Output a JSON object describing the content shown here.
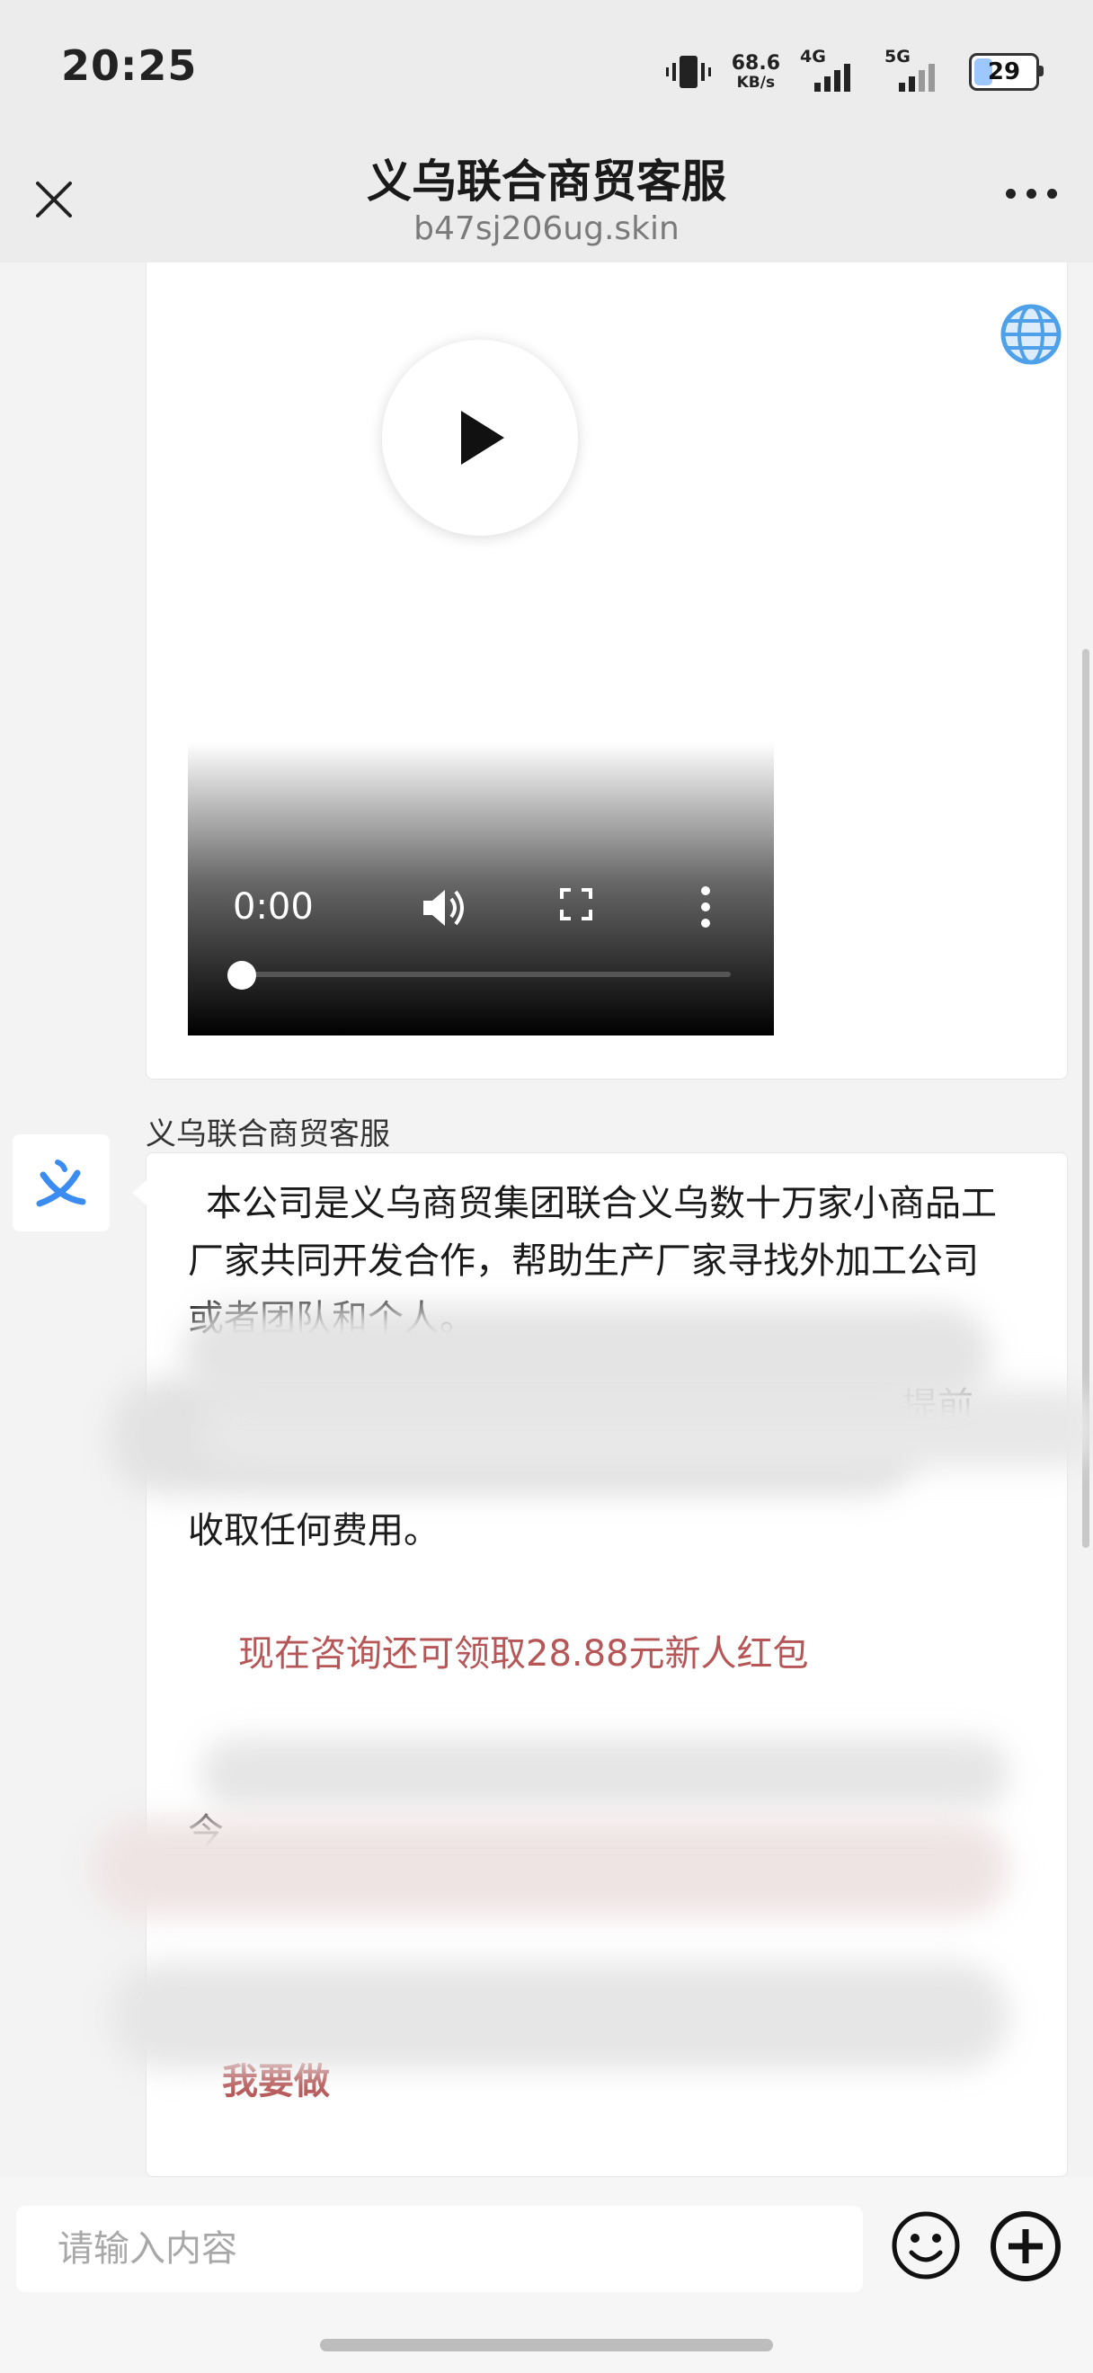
{
  "status_bar": {
    "time": "20:25",
    "speed_value": "68.6",
    "speed_unit": "KB/s",
    "net1": "4G",
    "net2": "5G",
    "battery": "29"
  },
  "header": {
    "title": "义乌联合商贸客服",
    "subtitle": "b47sj206ug.skin"
  },
  "video": {
    "time": "0:00",
    "progress": 0
  },
  "message": {
    "sender": "义乌联合商贸客服",
    "avatar_icon": "yi-logo-icon",
    "paragraph1": "本公司是义乌商贸集团联合义乌数十万家小商品工厂家共同开发合作，帮助生产厂家寻找外加工公司或者团队和个人。",
    "fragment_right": "提前",
    "paragraph2": "收取任何费用。",
    "promo": "现在咨询还可领取28.88元新人红包",
    "fragment_left": "今",
    "fragment_bottom": "我要做"
  },
  "input": {
    "placeholder": "请输入内容"
  },
  "colors": {
    "accent_red": "#b65656",
    "avatar_blue": "#3b8cf0"
  }
}
